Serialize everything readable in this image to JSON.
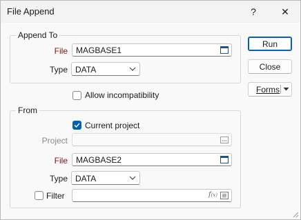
{
  "window": {
    "title": "File Append",
    "help": "?",
    "close": "✕"
  },
  "append_to": {
    "group_label": "Append To",
    "file_label": "File",
    "file_value": "MAGBASE1",
    "type_label": "Type",
    "type_value": "DATA"
  },
  "allow_incompat": {
    "label": "Allow incompatibility",
    "checked": false
  },
  "from": {
    "group_label": "From",
    "current_project_label": "Current project",
    "current_project_checked": true,
    "project_label": "Project",
    "project_value": "",
    "file_label": "File",
    "file_value": "MAGBASE2",
    "type_label": "Type",
    "type_value": "DATA",
    "filter_label": "Filter",
    "filter_checked": false,
    "filter_value": ""
  },
  "buttons": {
    "run": "Run",
    "close": "Close",
    "forms": "Forms"
  },
  "colors": {
    "accent": "#005fb8",
    "required_label": "#8a1010"
  }
}
